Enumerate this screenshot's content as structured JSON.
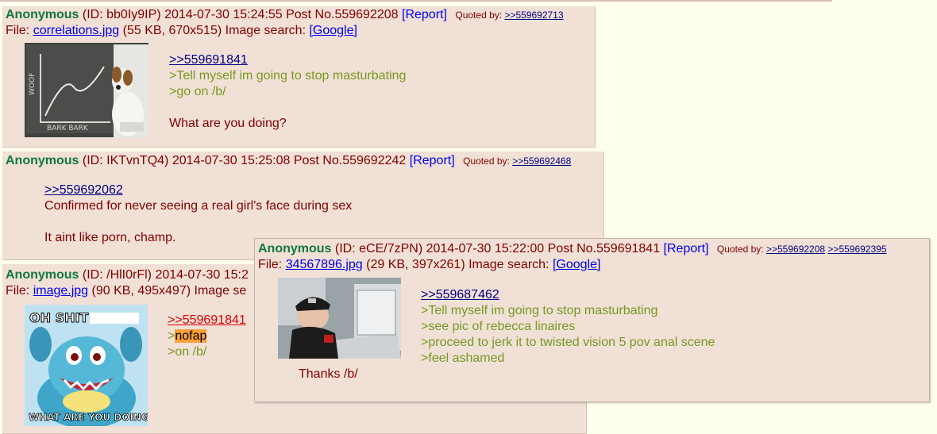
{
  "posts": [
    {
      "name": "Anonymous",
      "id_text": "(ID: bb0Iy9IP)",
      "datetime": "2014-07-30 15:24:55",
      "post_no": "Post No.559692208",
      "report": "[Report]",
      "quoted_by_label": "Quoted by:",
      "quoted_by": [
        ">>559692713"
      ],
      "file_label": "File:",
      "file_name": "correlations.jpg",
      "file_meta": "(55 KB, 670x515)",
      "image_search_label": "Image search:",
      "image_search_link": "[Google]",
      "image_desc": "dog-at-chalkboard-graph",
      "graph_axis_text": "WOOF",
      "graph_caption": "BARK BARK",
      "lines": [
        ">>559691841",
        ">Tell myself im going to stop masturbating",
        ">go on /b/",
        "",
        "What are you doing?"
      ]
    },
    {
      "name": "Anonymous",
      "id_text": "(ID: IKTvnTQ4)",
      "datetime": "2014-07-30 15:25:08",
      "post_no": "Post No.559692242",
      "report": "[Report]",
      "quoted_by_label": "Quoted by:",
      "quoted_by": [
        ">>559692468"
      ],
      "lines": [
        ">>559692062",
        "Confirmed for never seeing a real girl's face during sex",
        "",
        "It aint like porn, champ."
      ]
    },
    {
      "name": "Anonymous",
      "id_text": "(ID: /HlI0rFl)",
      "datetime": "2014-07-30 15:2",
      "file_label": "File:",
      "file_name": "image.jpg",
      "file_meta": "(90 KB, 495x497)",
      "image_search_label": "Image se",
      "image_desc": "cartoon-crocodile-meme",
      "meme_top": "OH SHIT",
      "meme_bottom": "WHAT ARE YOU DOING?",
      "quote_link": ">>559691841",
      "nofap_prefix": ">",
      "nofap": "nofap",
      "on_b": ">on /b/"
    },
    {
      "name": "Anonymous",
      "id_text": "(ID: eCE/7zPN)",
      "datetime": "2014-07-30 15:22:00",
      "post_no": "Post No.559691841",
      "report": "[Report]",
      "quoted_by_label": "Quoted by:",
      "quoted_by": [
        ">>559692208",
        ">>559692395"
      ],
      "file_label": "File:",
      "file_name": "34567896.jpg",
      "file_meta": "(29 KB, 397x261)",
      "image_search_label": "Image search:",
      "image_search_link": "[Google]",
      "image_desc": "man-in-uniform-at-laptop",
      "lines": [
        ">>559687462",
        ">Tell myself im going to stop masturbating",
        ">see pic of rebecca linaires",
        ">proceed to jerk it to twisted vision 5 pov anal scene",
        ">feel ashamed"
      ],
      "footer_text": "Thanks /b/"
    }
  ],
  "colors": {
    "page_bg": "#ffffee",
    "post_bg": "#f0e0d6",
    "name": "#117743",
    "text": "#800000",
    "greentext": "#789922",
    "link": "#0000ee",
    "quote_link": "#000080",
    "highlight": "#ffa13a"
  }
}
